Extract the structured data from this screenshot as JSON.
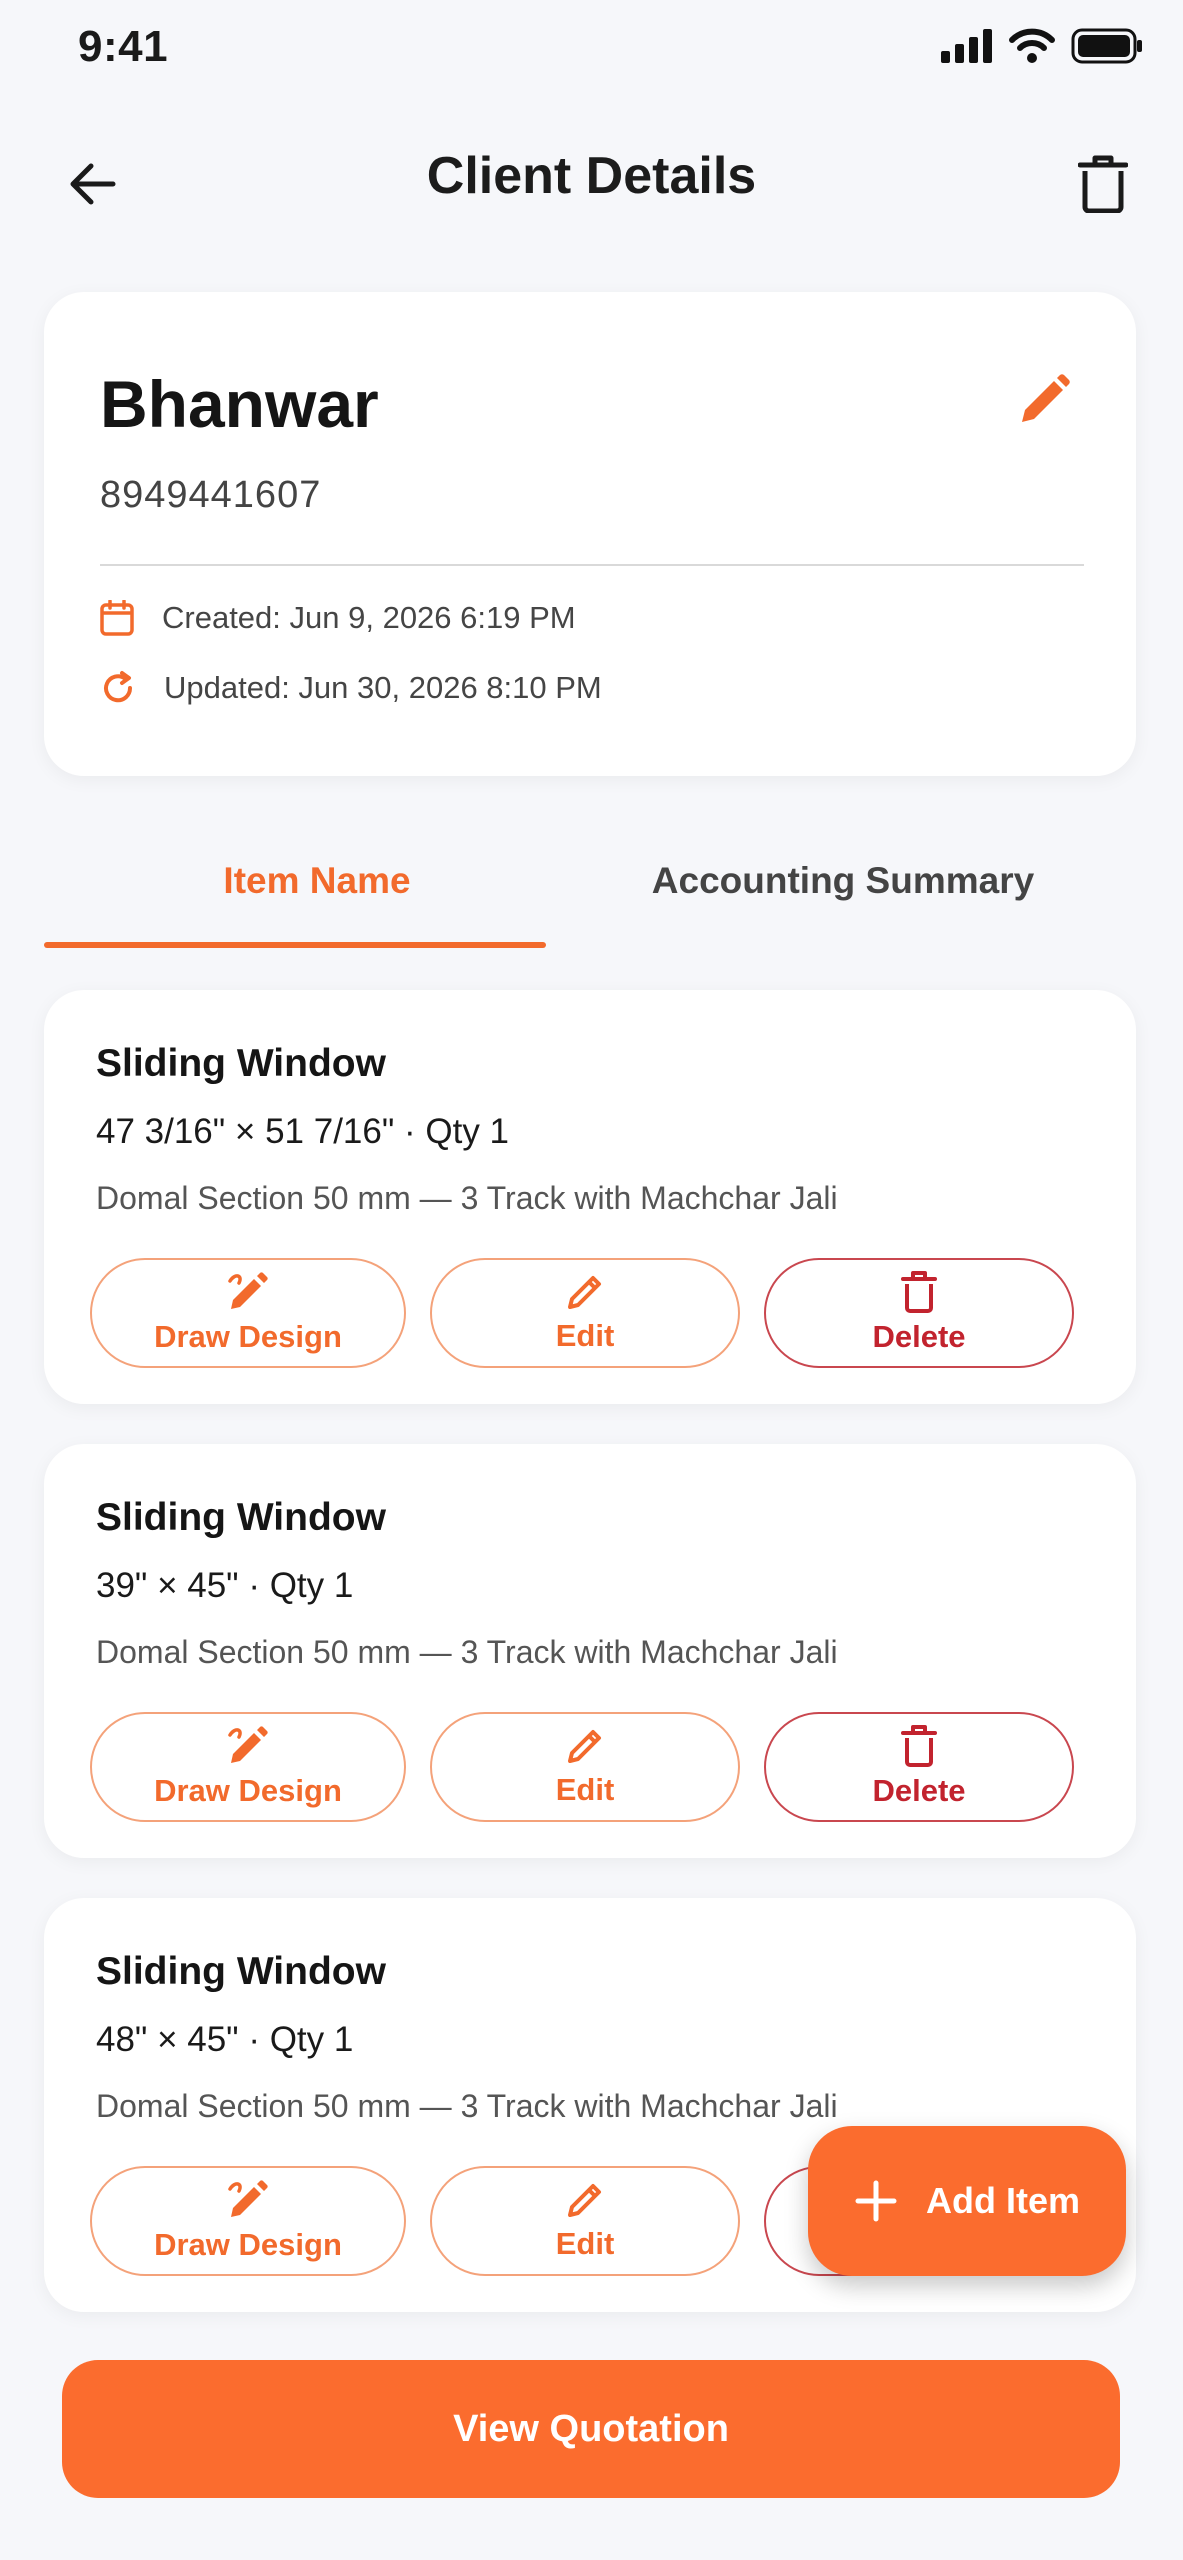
{
  "status_bar": {
    "time": "9:41"
  },
  "header": {
    "title": "Client Details"
  },
  "client": {
    "name": "Bhanwar",
    "phone": "8949441607",
    "created": "Created: Jun 9, 2026 6:19 PM",
    "updated": "Updated: Jun 30, 2026 8:10 PM"
  },
  "tabs": [
    {
      "label": "Item Name",
      "active": true
    },
    {
      "label": "Accounting Summary",
      "active": false
    }
  ],
  "items": [
    {
      "title": "Sliding Window",
      "dims": "47 3/16\" × 51 7/16\" · Qty 1",
      "desc": "Domal Section 50 mm — 3 Track with Machchar Jali"
    },
    {
      "title": "Sliding Window",
      "dims": "39\" × 45\" · Qty 1",
      "desc": "Domal Section 50 mm — 3 Track with Machchar Jali"
    },
    {
      "title": "Sliding Window",
      "dims": "48\" × 45\" · Qty 1",
      "desc": "Domal Section 50 mm — 3 Track with Machchar Jali"
    }
  ],
  "actions": {
    "draw": "Draw Design",
    "edit": "Edit",
    "delete": "Delete"
  },
  "fab": {
    "label": "Add Item"
  },
  "cta": {
    "label": "View Quotation"
  },
  "colors": {
    "accent": "#f26a2c",
    "danger": "#c2232e",
    "background": "#f6f7fa"
  }
}
